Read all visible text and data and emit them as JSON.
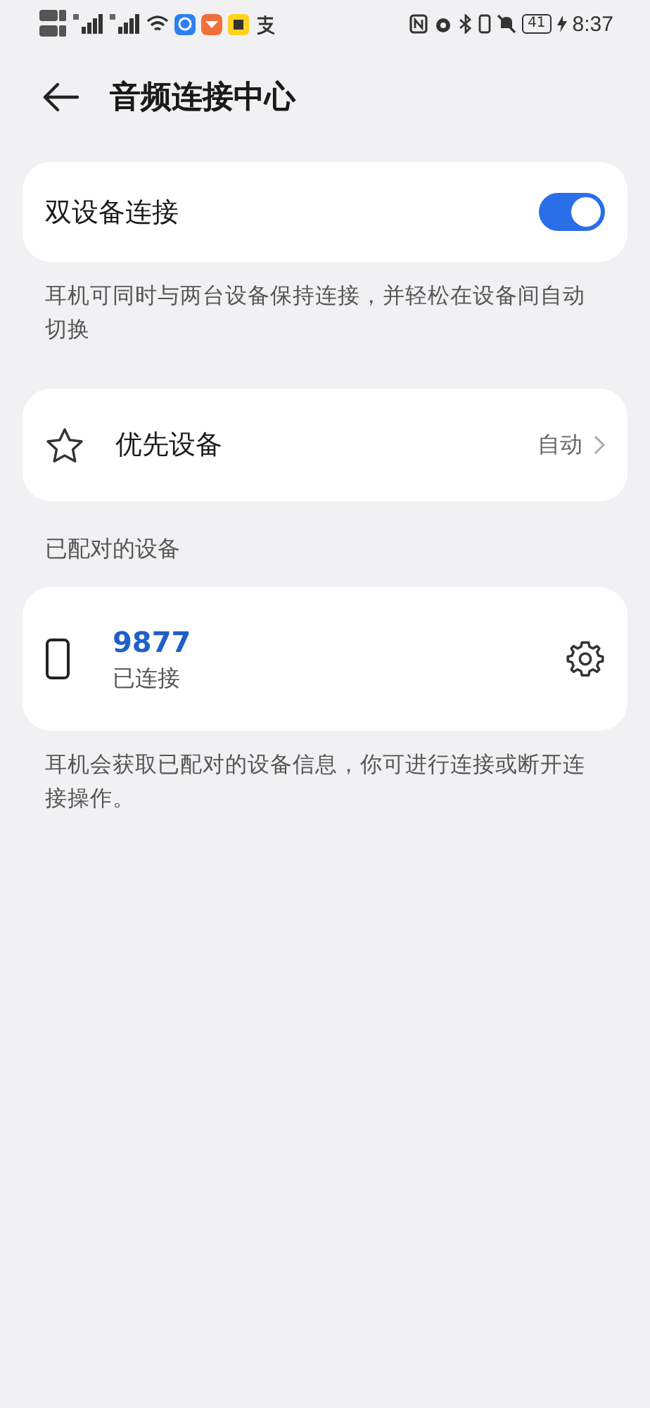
{
  "status_bar": {
    "battery": "41",
    "time": "8:37"
  },
  "header": {
    "title": "音频连接中心"
  },
  "dual_connection": {
    "label": "双设备连接",
    "on": true,
    "description": "耳机可同时与两台设备保持连接，并轻松在设备间自动切换"
  },
  "priority_device": {
    "label": "优先设备",
    "value": "自动"
  },
  "paired_section": {
    "title": "已配对的设备"
  },
  "devices": [
    {
      "name": "9877",
      "status": "已连接"
    }
  ],
  "footer_note": "耳机会获取已配对的设备信息，你可进行连接或断开连接操作。"
}
